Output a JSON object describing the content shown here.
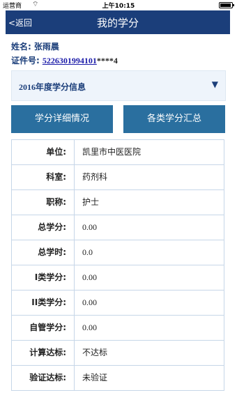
{
  "status_bar": {
    "carrier": "运营商",
    "time": "上午10:15"
  },
  "nav": {
    "back": "<返回",
    "title": "我的学分"
  },
  "person": {
    "name_label": "姓名:",
    "name": "张雨晨",
    "id_label": "证件号:",
    "id_visible": "5226301994101",
    "id_masked": "****4"
  },
  "year_select": {
    "value": "2016年度学分信息"
  },
  "buttons": {
    "detail": "学分详细情况",
    "summary": "各类学分汇总"
  },
  "table": {
    "rows": [
      {
        "key": "单位:",
        "value": "凯里市中医医院"
      },
      {
        "key": "科室:",
        "value": "药剂科"
      },
      {
        "key": "职称:",
        "value": "护士"
      },
      {
        "key": "总学分:",
        "value": "0.00"
      },
      {
        "key": "总学时:",
        "value": "0.0"
      },
      {
        "key": "I类学分:",
        "value": "0.00"
      },
      {
        "key": "II类学分:",
        "value": "0.00"
      },
      {
        "key": "自管学分:",
        "value": "0.00"
      },
      {
        "key": "计算达标:",
        "value": "不达标"
      },
      {
        "key": "验证达标:",
        "value": "未验证"
      }
    ]
  }
}
